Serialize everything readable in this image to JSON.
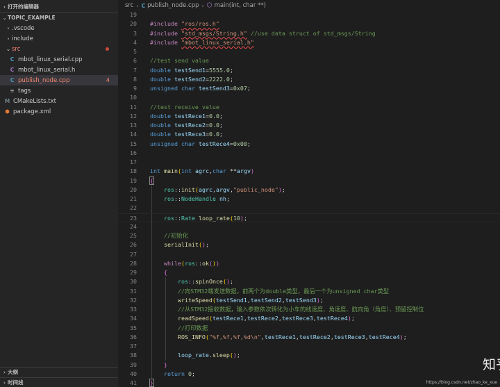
{
  "sidebar": {
    "open_editors_title": "打开的编辑器",
    "project_title": "TOPIC_EXAMPLE",
    "tree": [
      {
        "label": "vscode",
        "kind": "folder",
        "collapsed": true,
        "display": ".vscode"
      },
      {
        "label": "include",
        "kind": "folder",
        "collapsed": true
      },
      {
        "label": "src",
        "kind": "folder",
        "collapsed": false,
        "modified": true
      },
      {
        "label": "mbot_linux_serial.cpp",
        "icon": "C",
        "kind": "file-cpp"
      },
      {
        "label": "mbot_linux_serial.h",
        "icon": "C",
        "kind": "file-h"
      },
      {
        "label": "publish_node.cpp",
        "icon": "C",
        "kind": "file-cpp",
        "selected": true,
        "problems": "4"
      },
      {
        "label": "tags",
        "kind": "file-tags"
      },
      {
        "label": "CMakeLists.txt",
        "icon": "M",
        "kind": "file-cmake"
      },
      {
        "label": "package.xml",
        "icon": "⬢",
        "kind": "file-xml"
      }
    ],
    "outline_title": "大纲",
    "timeline_title": "时间线"
  },
  "breadcrumb": {
    "folder": "src",
    "file": "publish_node.cpp",
    "symbol": "main(int, char **)"
  },
  "editor": {
    "lines": [
      {
        "n": "19",
        "text": ""
      },
      {
        "n": "20",
        "text": "#include \"ros/ros.h\""
      },
      {
        "n": "3",
        "text": "#include \"std_msgs/String.h\" //use data struct of std_msgs/String"
      },
      {
        "n": "4",
        "text": "#include \"mbot_linux_serial.h\""
      },
      {
        "n": "5",
        "text": ""
      },
      {
        "n": "6",
        "text": "//test send value"
      },
      {
        "n": "7",
        "text": "double testSend1=5555.0;"
      },
      {
        "n": "8",
        "text": "double testSend2=2222.0;"
      },
      {
        "n": "9",
        "text": "unsigned char testSend3=0x07;"
      },
      {
        "n": "10",
        "text": ""
      },
      {
        "n": "11",
        "text": "//test receive value"
      },
      {
        "n": "12",
        "text": "double testRece1=0.0;"
      },
      {
        "n": "13",
        "text": "double testRece2=0.0;"
      },
      {
        "n": "14",
        "text": "double testRece3=0.0;"
      },
      {
        "n": "15",
        "text": "unsigned char testRece4=0x00;"
      },
      {
        "n": "16",
        "text": ""
      },
      {
        "n": "17",
        "text": ""
      },
      {
        "n": "18",
        "text": "int main(int agrc,char **argv)"
      },
      {
        "n": "19",
        "text": "{"
      },
      {
        "n": "20",
        "text": "    ros::init(agrc,argv,\"public_node\");"
      },
      {
        "n": "21",
        "text": "    ros::NodeHandle nh;"
      },
      {
        "n": "22",
        "text": ""
      },
      {
        "n": "23",
        "text": "    ros::Rate loop_rate(10);"
      },
      {
        "n": "24",
        "text": ""
      },
      {
        "n": "25",
        "text": "    //初始化"
      },
      {
        "n": "26",
        "text": "    serialInit();"
      },
      {
        "n": "27",
        "text": ""
      },
      {
        "n": "28",
        "text": "    while(ros::ok())"
      },
      {
        "n": "29",
        "text": "    {"
      },
      {
        "n": "30",
        "text": "        ros::spinOnce();"
      },
      {
        "n": "31",
        "text": "        //向STM32端发送数据，前两个为double类型，最后一个为unsigned char类型"
      },
      {
        "n": "32",
        "text": "        writeSpeed(testSend1,testSend2,testSend3);"
      },
      {
        "n": "33",
        "text": "        //从STM32接收数据，输入参数依次转化为小车的线速度、角速度、航向角（角度）、预留控制位"
      },
      {
        "n": "34",
        "text": "        readSpeed(testRece1,testRece2,testRece3,testRece4);"
      },
      {
        "n": "35",
        "text": "        //打印数据"
      },
      {
        "n": "36",
        "text": "        ROS_INFO(\"%f,%f,%f,%d\\n\",testRece1,testRece2,testRece3,testRece4);"
      },
      {
        "n": "37",
        "text": ""
      },
      {
        "n": "38",
        "text": "        loop_rate.sleep();"
      },
      {
        "n": "39",
        "text": "    }"
      },
      {
        "n": "40",
        "text": "    return 0;"
      },
      {
        "n": "41",
        "text": "}"
      }
    ]
  },
  "watermark": {
    "text": "知乎 @沉醉不知路",
    "url": "https://blog.csdn.net/zhao_ke_xue"
  },
  "colors": {
    "keyword": "#569cd6",
    "preprocessor": "#c586c0",
    "string": "#ce9178",
    "number": "#b5cea8",
    "comment": "#6a9955",
    "function": "#dcdcaa",
    "variable": "#9cdcfe",
    "error_squiggle": "#f14c4c"
  }
}
